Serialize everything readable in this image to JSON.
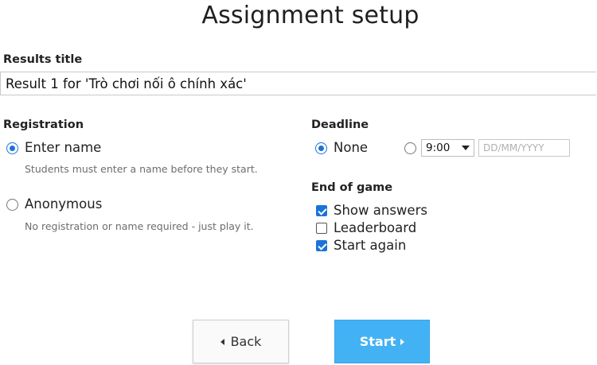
{
  "header": {
    "title": "Assignment setup"
  },
  "results": {
    "label": "Results title",
    "value": "Result 1 for 'Trò chơi nối ô chính xác'"
  },
  "registration": {
    "label": "Registration",
    "options": [
      {
        "label": "Enter name",
        "hint": "Students must enter a name before they start.",
        "selected": true
      },
      {
        "label": "Anonymous",
        "hint": "No registration or name required - just play it.",
        "selected": false
      }
    ]
  },
  "deadline": {
    "label": "Deadline",
    "none_label": "None",
    "none_selected": true,
    "time_value": "9:00",
    "date_placeholder": "DD/MM/YYYY"
  },
  "end_of_game": {
    "label": "End of game",
    "options": [
      {
        "label": "Show answers",
        "checked": true
      },
      {
        "label": "Leaderboard",
        "checked": false
      },
      {
        "label": "Start again",
        "checked": true
      }
    ]
  },
  "buttons": {
    "back": "Back",
    "start": "Start"
  },
  "colors": {
    "accent": "#1a73d9",
    "start_button": "#43b2f5"
  }
}
